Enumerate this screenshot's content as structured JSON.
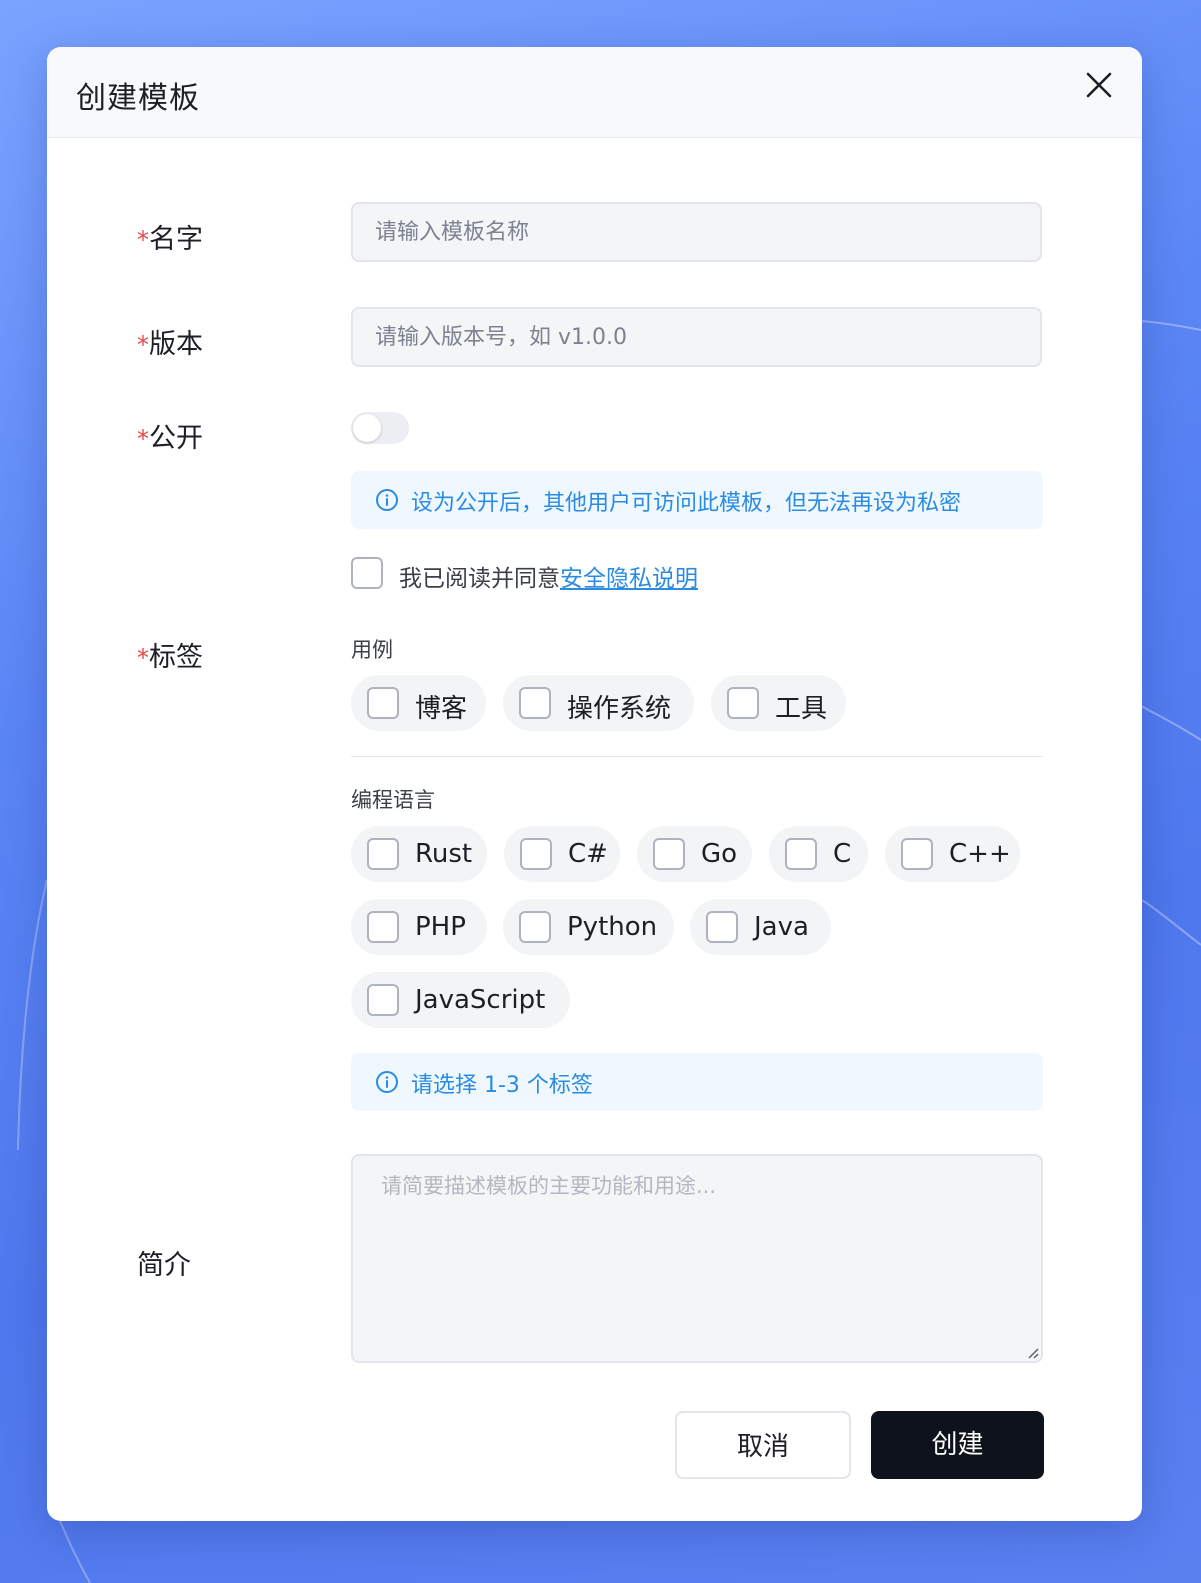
{
  "dialog": {
    "title": "创建模板",
    "close_icon": "close-icon"
  },
  "form": {
    "name": {
      "required_mark": "*",
      "label": "名字",
      "placeholder": "请输入模板名称",
      "value": ""
    },
    "version": {
      "required_mark": "*",
      "label": "版本",
      "placeholder": "请输入版本号，如 v1.0.0",
      "value": ""
    },
    "public": {
      "required_mark": "*",
      "label": "公开",
      "enabled": false,
      "info_icon": "info-icon",
      "info_text": "设为公开后，其他用户可访问此模板，但无法再设为私密",
      "agree_text": "我已阅读并同意",
      "agree_link": "安全隐私说明",
      "agreed": false
    },
    "tags": {
      "required_mark": "*",
      "label": "标签",
      "groups": [
        {
          "title": "用例",
          "options": [
            "博客",
            "操作系统",
            "工具"
          ]
        },
        {
          "title": "编程语言",
          "options": [
            "Rust",
            "C#",
            "Go",
            "C",
            "C++",
            "PHP",
            "Python",
            "Java",
            "JavaScript"
          ]
        }
      ],
      "info_icon": "info-icon",
      "info_text": "请选择 1-3 个标签"
    },
    "description": {
      "label": "简介",
      "placeholder": "请简要描述模板的主要功能和用途...",
      "value": ""
    }
  },
  "actions": {
    "cancel_label": "取消",
    "create_label": "创建"
  },
  "colors": {
    "background": "#5b86f5",
    "primary_button": "#0d121c",
    "info_text": "#2b8be3",
    "info_background": "#eff8ff",
    "required": "#e5484d"
  }
}
